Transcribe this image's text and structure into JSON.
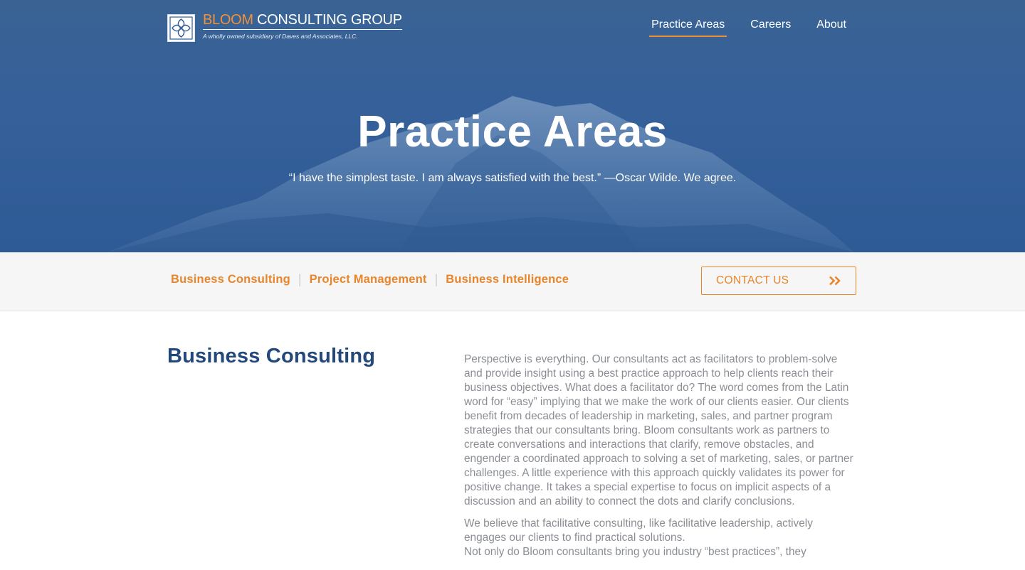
{
  "header": {
    "logo": {
      "brand": "BLOOM",
      "name_rest": " CONSULTING GROUP",
      "tagline": "A wholly owned subsidiary of Daves and Associates, LLC."
    },
    "nav": [
      {
        "label": "Practice Areas",
        "active": true
      },
      {
        "label": "Careers",
        "active": false
      },
      {
        "label": "About",
        "active": false
      }
    ]
  },
  "hero": {
    "title": "Practice Areas",
    "quote": "“I have the simplest taste. I am always satisfied with the best.” —Oscar Wilde. We agree."
  },
  "subnav": {
    "links": [
      "Business Consulting",
      "Project Management",
      "Business Intelligence"
    ],
    "separator": "|",
    "contact_label": "CONTACT US",
    "contact_icon": "double-chevron-right-icon"
  },
  "content": {
    "heading": "Business Consulting",
    "paragraphs": [
      "Perspective is everything. Our consultants act as facilitators to problem-solve and provide insight using a best practice approach to help clients reach their business objectives. What does a facilitator do? The word comes from the Latin word for “easy” implying that we make the work of our clients easier. Our clients benefit from decades of leadership in marketing, sales, and partner program strategies that our consultants bring. Bloom consultants work as partners to create conversations and interactions that clarify, remove obstacles, and engender a coordinated approach to solving a set of marketing, sales, or partner challenges. A little experience with this approach quickly validates its power for positive change. It takes a special expertise to focus on implicit aspects of a discussion and an ability to connect the dots and clarify conclusions.",
      "We believe that facilitative consulting, like facilitative leadership, actively engages our clients to find practical solutions.",
      "Not only do Bloom consultants bring you industry “best practices”, they"
    ]
  },
  "colors": {
    "accent": "#e8852a",
    "heading": "#22487c",
    "hero": "#35609a",
    "body_text": "#8a8e94"
  }
}
